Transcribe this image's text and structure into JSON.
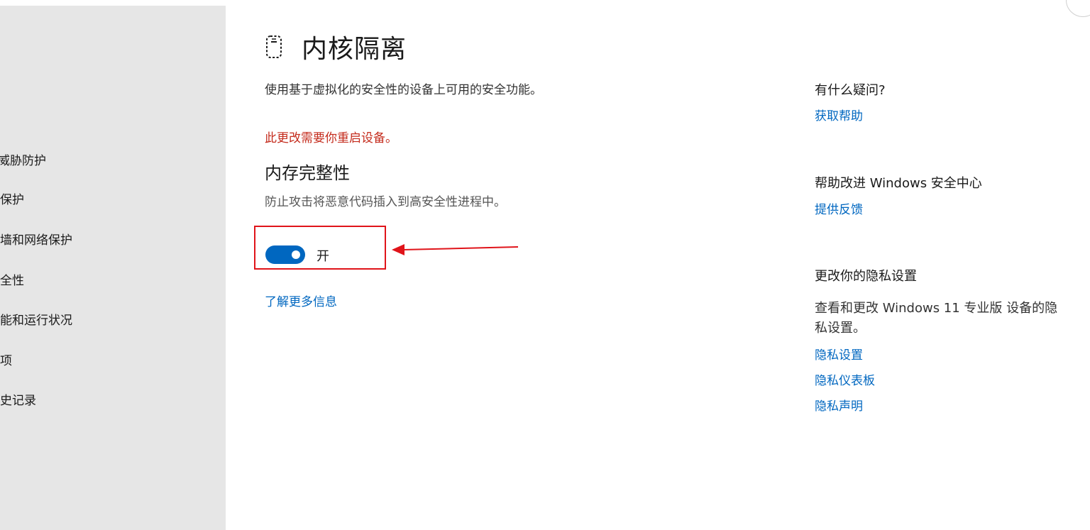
{
  "sidebar": {
    "items": [
      {
        "label": "病毒和威胁防护"
      },
      {
        "label": "帐户保护"
      },
      {
        "label": "防火墙和网络保护"
      },
      {
        "label": "设备安全性"
      },
      {
        "label": "设备性能和运行状况"
      },
      {
        "label": "家庭选项"
      },
      {
        "label": "保护历史记录"
      }
    ]
  },
  "main": {
    "title": "内核隔离",
    "title_icon": "core-isolation-chip-icon",
    "description": "使用基于虚拟化的安全性的设备上可用的安全功能。",
    "restart_warning": "此更改需要你重启设备。",
    "section": {
      "title": "内存完整性",
      "description": "防止攻击将恶意代码插入到高安全性进程中。",
      "toggle_state": true,
      "toggle_label": "开"
    },
    "learn_more": "了解更多信息"
  },
  "aside": {
    "question_heading": "有什么疑问?",
    "get_help": "获取帮助",
    "improve_heading": "帮助改进 Windows 安全中心",
    "feedback": "提供反馈",
    "privacy_heading": "更改你的隐私设置",
    "privacy_text": "查看和更改 Windows 11 专业版 设备的隐私设置。",
    "privacy_links": [
      "隐私设置",
      "隐私仪表板",
      "隐私声明"
    ]
  },
  "colors": {
    "accent": "#0067c0",
    "warning": "#c42b1c",
    "annotation": "#e0141a",
    "sidebar_bg": "#e6e6e6"
  }
}
